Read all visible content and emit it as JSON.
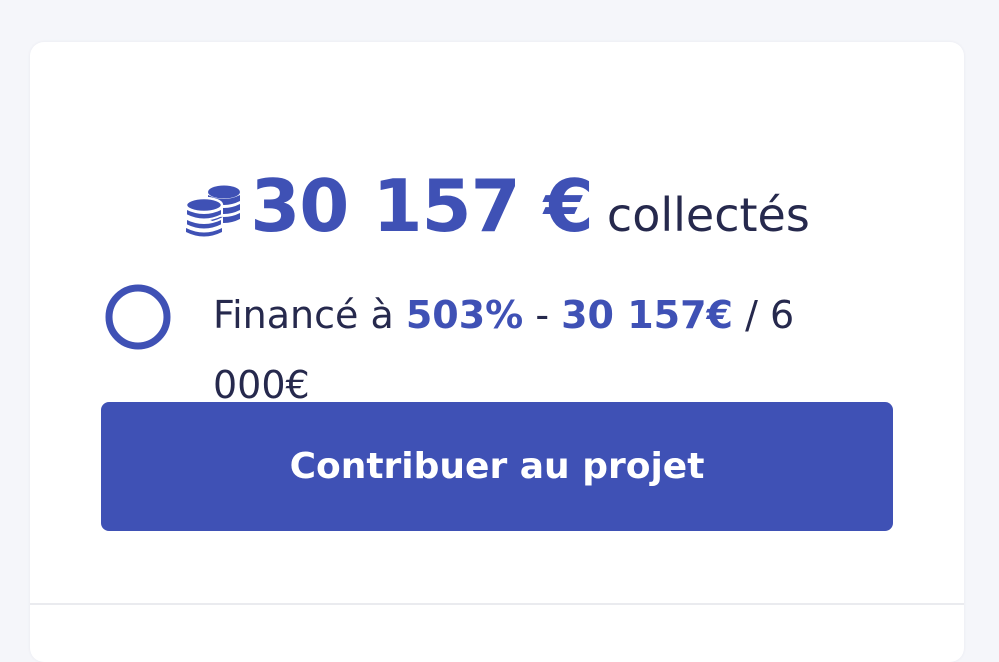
{
  "funding": {
    "amount": "30 157 €",
    "collected_label": "collectés",
    "percent_prefix": "Financé à ",
    "percent": "503%",
    "separator": " - ",
    "raised": "30 157€",
    "goal_text": " / 6 000€",
    "progress_fraction": 1.0
  },
  "cta": {
    "label": "Contribuer au projet"
  },
  "colors": {
    "accent": "#3f51b5",
    "text_dark": "#26294d",
    "background": "#f5f6fa",
    "card": "#ffffff"
  },
  "icons": {
    "amount_icon": "coins-icon",
    "progress_icon": "circle-progress-icon"
  }
}
